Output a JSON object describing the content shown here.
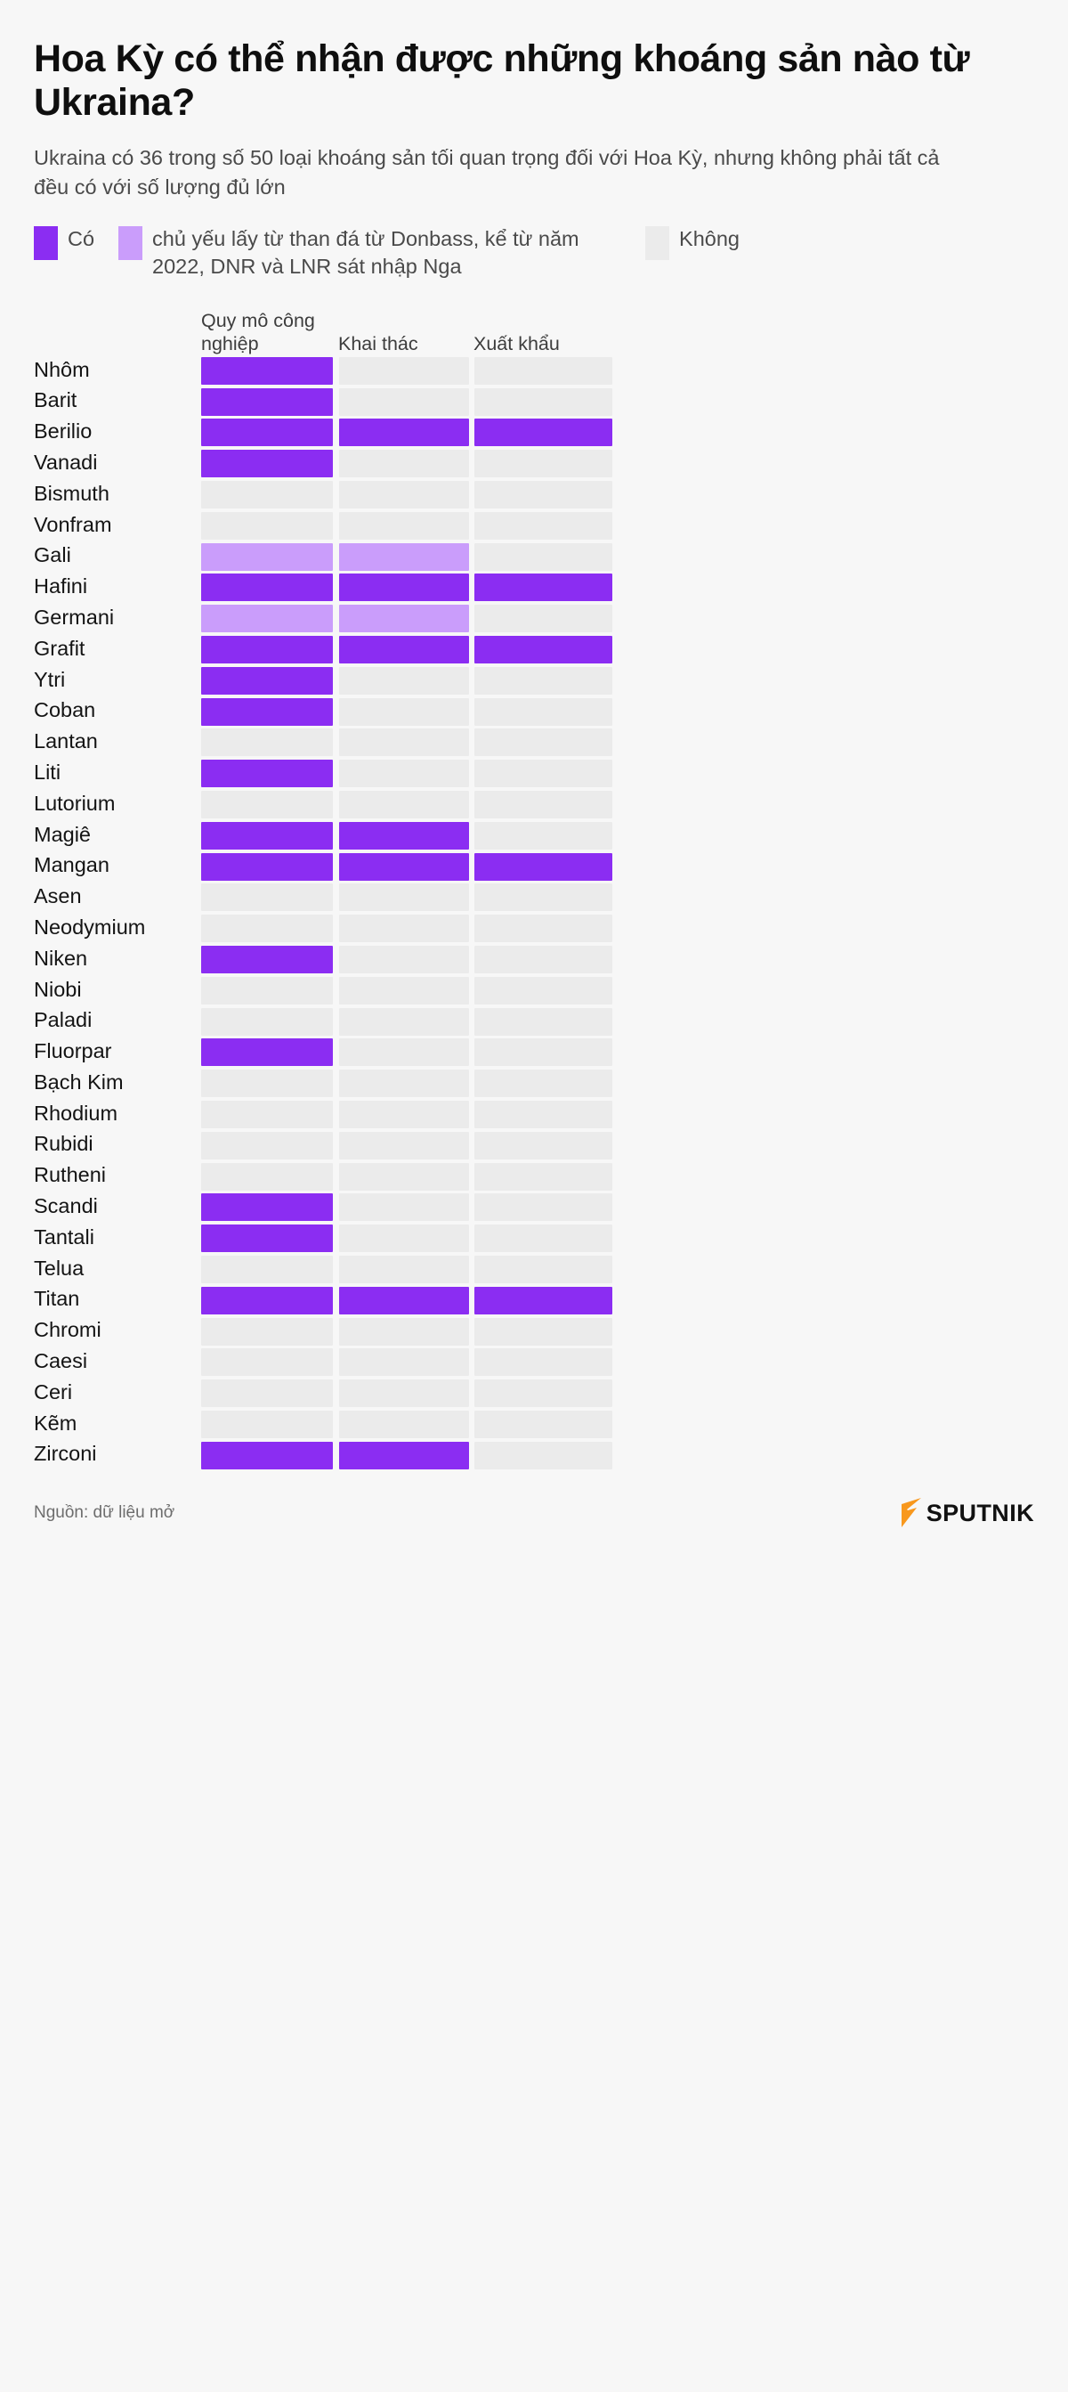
{
  "header": {
    "title": "Hoa Kỳ có thể nhận được những khoáng sản nào từ Ukraina?",
    "subtitle": "Ukraina có 36 trong số 50 loại khoáng sản tối quan trọng đối với Hoa Kỳ, nhưng không phải tất cả đều có với số lượng đủ lớn"
  },
  "legend": {
    "items": [
      {
        "key": "yes",
        "label": "Có",
        "color": "#8b2df2"
      },
      {
        "key": "partial",
        "label": "chủ yếu lấy từ than đá từ Donbass, kể từ năm 2022, DNR và LNR sát nhập Nga",
        "color": "#ca9dfb"
      },
      {
        "key": "no",
        "label": "Không",
        "color": "#ebebeb"
      }
    ]
  },
  "table": {
    "columns": [
      "Quy mô công nghiệp",
      "Khai thác",
      "Xuất khẩu"
    ],
    "rows": [
      {
        "name": "Nhôm",
        "values": [
          "yes",
          "no",
          "no"
        ]
      },
      {
        "name": "Barit",
        "values": [
          "yes",
          "no",
          "no"
        ]
      },
      {
        "name": "Berilio",
        "values": [
          "yes",
          "yes",
          "yes"
        ]
      },
      {
        "name": "Vanadi",
        "values": [
          "yes",
          "no",
          "no"
        ]
      },
      {
        "name": "Bismuth",
        "values": [
          "no",
          "no",
          "no"
        ]
      },
      {
        "name": "Vonfram",
        "values": [
          "no",
          "no",
          "no"
        ]
      },
      {
        "name": "Gali",
        "values": [
          "partial",
          "partial",
          "no"
        ]
      },
      {
        "name": "Hafini",
        "values": [
          "yes",
          "yes",
          "yes"
        ]
      },
      {
        "name": "Germani",
        "values": [
          "partial",
          "partial",
          "no"
        ]
      },
      {
        "name": "Grafit",
        "values": [
          "yes",
          "yes",
          "yes"
        ]
      },
      {
        "name": "Ytri",
        "values": [
          "yes",
          "no",
          "no"
        ]
      },
      {
        "name": "Coban",
        "values": [
          "yes",
          "no",
          "no"
        ]
      },
      {
        "name": "Lantan",
        "values": [
          "no",
          "no",
          "no"
        ]
      },
      {
        "name": "Liti",
        "values": [
          "yes",
          "no",
          "no"
        ]
      },
      {
        "name": "Lutorium",
        "values": [
          "no",
          "no",
          "no"
        ]
      },
      {
        "name": "Magiê",
        "values": [
          "yes",
          "yes",
          "no"
        ]
      },
      {
        "name": "Mangan",
        "values": [
          "yes",
          "yes",
          "yes"
        ]
      },
      {
        "name": "Asen",
        "values": [
          "no",
          "no",
          "no"
        ]
      },
      {
        "name": "Neodymium",
        "values": [
          "no",
          "no",
          "no"
        ]
      },
      {
        "name": "Niken",
        "values": [
          "yes",
          "no",
          "no"
        ]
      },
      {
        "name": "Niobi",
        "values": [
          "no",
          "no",
          "no"
        ]
      },
      {
        "name": "Paladi",
        "values": [
          "no",
          "no",
          "no"
        ]
      },
      {
        "name": "Fluorpar",
        "values": [
          "yes",
          "no",
          "no"
        ]
      },
      {
        "name": "Bạch Kim",
        "values": [
          "no",
          "no",
          "no"
        ]
      },
      {
        "name": "Rhodium",
        "values": [
          "no",
          "no",
          "no"
        ]
      },
      {
        "name": "Rubidi",
        "values": [
          "no",
          "no",
          "no"
        ]
      },
      {
        "name": "Rutheni",
        "values": [
          "no",
          "no",
          "no"
        ]
      },
      {
        "name": "Scandi",
        "values": [
          "yes",
          "no",
          "no"
        ]
      },
      {
        "name": "Tantali",
        "values": [
          "yes",
          "no",
          "no"
        ]
      },
      {
        "name": "Telua",
        "values": [
          "no",
          "no",
          "no"
        ]
      },
      {
        "name": "Titan",
        "values": [
          "yes",
          "yes",
          "yes"
        ]
      },
      {
        "name": "Chromi",
        "values": [
          "no",
          "no",
          "no"
        ]
      },
      {
        "name": "Caesi",
        "values": [
          "no",
          "no",
          "no"
        ]
      },
      {
        "name": "Ceri",
        "values": [
          "no",
          "no",
          "no"
        ]
      },
      {
        "name": "Kẽm",
        "values": [
          "no",
          "no",
          "no"
        ]
      },
      {
        "name": "Zirconi",
        "values": [
          "yes",
          "yes",
          "no"
        ]
      }
    ]
  },
  "footer": {
    "source": "Nguồn: dữ liệu mở",
    "brand": "SPUTNIK",
    "brand_accent": "#f8981d"
  },
  "chart_data": {
    "type": "heatmap",
    "title": "Hoa Kỳ có thể nhận được những khoáng sản nào từ Ukraina?",
    "subtitle": "Ukraina có 36 trong số 50 loại khoáng sản tối quan trọng đối với Hoa Kỳ, nhưng không phải tất cả đều có với số lượng đủ lớn",
    "xlabel": "",
    "ylabel": "",
    "categories": [
      "Quy mô công nghiệp",
      "Khai thác",
      "Xuất khẩu"
    ],
    "value_scale": {
      "yes": "Có",
      "partial": "chủ yếu lấy từ than đá từ Donbass, kể từ năm 2022, DNR và LNR sát nhập Nga",
      "no": "Không"
    },
    "legend_position": "top",
    "grid": false,
    "rows": [
      {
        "name": "Nhôm",
        "values": [
          "yes",
          "no",
          "no"
        ]
      },
      {
        "name": "Barit",
        "values": [
          "yes",
          "no",
          "no"
        ]
      },
      {
        "name": "Berilio",
        "values": [
          "yes",
          "yes",
          "yes"
        ]
      },
      {
        "name": "Vanadi",
        "values": [
          "yes",
          "no",
          "no"
        ]
      },
      {
        "name": "Bismuth",
        "values": [
          "no",
          "no",
          "no"
        ]
      },
      {
        "name": "Vonfram",
        "values": [
          "no",
          "no",
          "no"
        ]
      },
      {
        "name": "Gali",
        "values": [
          "partial",
          "partial",
          "no"
        ]
      },
      {
        "name": "Hafini",
        "values": [
          "yes",
          "yes",
          "yes"
        ]
      },
      {
        "name": "Germani",
        "values": [
          "partial",
          "partial",
          "no"
        ]
      },
      {
        "name": "Grafit",
        "values": [
          "yes",
          "yes",
          "yes"
        ]
      },
      {
        "name": "Ytri",
        "values": [
          "yes",
          "no",
          "no"
        ]
      },
      {
        "name": "Coban",
        "values": [
          "yes",
          "no",
          "no"
        ]
      },
      {
        "name": "Lantan",
        "values": [
          "no",
          "no",
          "no"
        ]
      },
      {
        "name": "Liti",
        "values": [
          "yes",
          "no",
          "no"
        ]
      },
      {
        "name": "Lutorium",
        "values": [
          "no",
          "no",
          "no"
        ]
      },
      {
        "name": "Magiê",
        "values": [
          "yes",
          "yes",
          "no"
        ]
      },
      {
        "name": "Mangan",
        "values": [
          "yes",
          "yes",
          "yes"
        ]
      },
      {
        "name": "Asen",
        "values": [
          "no",
          "no",
          "no"
        ]
      },
      {
        "name": "Neodymium",
        "values": [
          "no",
          "no",
          "no"
        ]
      },
      {
        "name": "Niken",
        "values": [
          "yes",
          "no",
          "no"
        ]
      },
      {
        "name": "Niobi",
        "values": [
          "no",
          "no",
          "no"
        ]
      },
      {
        "name": "Paladi",
        "values": [
          "no",
          "no",
          "no"
        ]
      },
      {
        "name": "Fluorpar",
        "values": [
          "yes",
          "no",
          "no"
        ]
      },
      {
        "name": "Bạch Kim",
        "values": [
          "no",
          "no",
          "no"
        ]
      },
      {
        "name": "Rhodium",
        "values": [
          "no",
          "no",
          "no"
        ]
      },
      {
        "name": "Rubidi",
        "values": [
          "no",
          "no",
          "no"
        ]
      },
      {
        "name": "Rutheni",
        "values": [
          "no",
          "no",
          "no"
        ]
      },
      {
        "name": "Scandi",
        "values": [
          "yes",
          "no",
          "no"
        ]
      },
      {
        "name": "Tantali",
        "values": [
          "yes",
          "no",
          "no"
        ]
      },
      {
        "name": "Telua",
        "values": [
          "no",
          "no",
          "no"
        ]
      },
      {
        "name": "Titan",
        "values": [
          "yes",
          "yes",
          "yes"
        ]
      },
      {
        "name": "Chromi",
        "values": [
          "no",
          "no",
          "no"
        ]
      },
      {
        "name": "Caesi",
        "values": [
          "no",
          "no",
          "no"
        ]
      },
      {
        "name": "Ceri",
        "values": [
          "no",
          "no",
          "no"
        ]
      },
      {
        "name": "Kẽm",
        "values": [
          "no",
          "no",
          "no"
        ]
      },
      {
        "name": "Zirconi",
        "values": [
          "yes",
          "yes",
          "no"
        ]
      }
    ],
    "source": "Nguồn: dữ liệu mở"
  }
}
